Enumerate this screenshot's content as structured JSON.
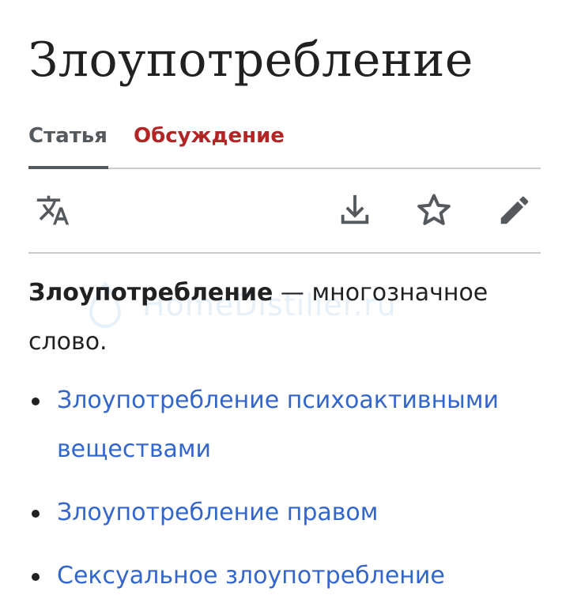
{
  "page": {
    "title": "Злоупотребление"
  },
  "tabs": {
    "article": "Статья",
    "talk": "Обсуждение"
  },
  "toolbar": {
    "language_icon": "translate-icon",
    "download_icon": "download-icon",
    "watch_icon": "star-icon",
    "edit_icon": "pencil-icon"
  },
  "content": {
    "lead_bold": "Злоупотребление",
    "lead_rest": " — многозначное слово.",
    "links": [
      "Злоупотребление психоактивными веществами",
      "Злоупотребление правом",
      "Сексуальное злоупотребление"
    ]
  },
  "watermark": {
    "text": "HomeDistiller.ru"
  },
  "colors": {
    "text": "#202122",
    "link": "#3366cc",
    "talk_tab": "#b32424",
    "tab_inactive": "#54595d",
    "divider": "#c8ccd1"
  }
}
